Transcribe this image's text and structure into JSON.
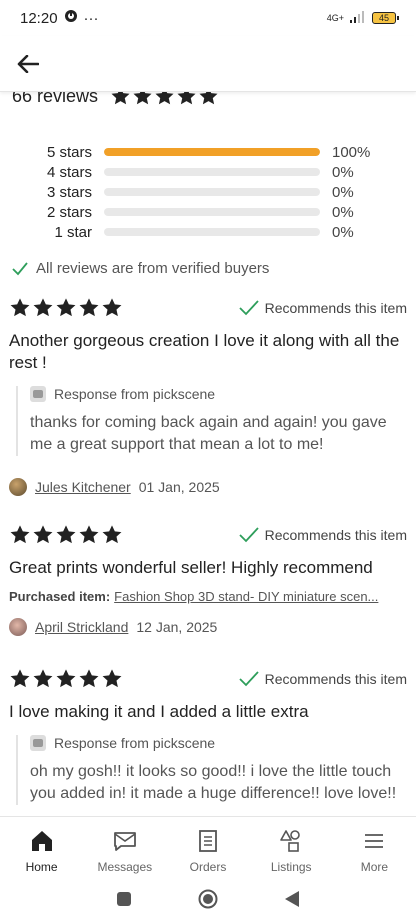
{
  "status_bar": {
    "time": "12:20",
    "extra": "···",
    "network": "4G+",
    "battery": "45"
  },
  "summary": {
    "count_label": "66 reviews",
    "rating_stars": 5,
    "distribution": [
      {
        "label": "5 stars",
        "pct": "100%",
        "fill": 1.0
      },
      {
        "label": "4 stars",
        "pct": "0%",
        "fill": 0
      },
      {
        "label": "3 stars",
        "pct": "0%",
        "fill": 0
      },
      {
        "label": "2 stars",
        "pct": "0%",
        "fill": 0
      },
      {
        "label": "1 star",
        "pct": "0%",
        "fill": 0
      }
    ],
    "verified_text": "All reviews are from verified buyers"
  },
  "reviews": [
    {
      "stars": 5,
      "recommends": "Recommends this item",
      "text": "Another gorgeous creation I love it along with all the rest !",
      "response_label": "Response from pickscene",
      "response_text": "thanks for coming back again and again! you gave me a great support that mean a lot to me!",
      "author": "Jules Kitchener",
      "date": "01 Jan, 2025"
    },
    {
      "stars": 5,
      "recommends": "Recommends this item",
      "text": "Great prints wonderful seller! Highly recommend",
      "purchased_label": "Purchased item:",
      "purchased_item": "Fashion Shop 3D stand- DIY miniature scen...",
      "author": "April Strickland",
      "date": "12 Jan, 2025"
    },
    {
      "stars": 5,
      "recommends": "Recommends this item",
      "text": "I love making it and I added a little extra",
      "response_label": "Response from pickscene",
      "response_text": "oh my gosh!! it looks so good!! i love the little touch you added in! it made a huge difference!! love love!!"
    }
  ],
  "bottom_nav": [
    {
      "label": "Home",
      "icon": "home-icon",
      "active": true
    },
    {
      "label": "Messages",
      "icon": "mail-icon"
    },
    {
      "label": "Orders",
      "icon": "receipt-icon"
    },
    {
      "label": "Listings",
      "icon": "shapes-icon"
    },
    {
      "label": "More",
      "icon": "menu-icon"
    }
  ],
  "colors": {
    "accent": "#f1a027",
    "star": "#222222",
    "check": "#2e9e5b"
  }
}
